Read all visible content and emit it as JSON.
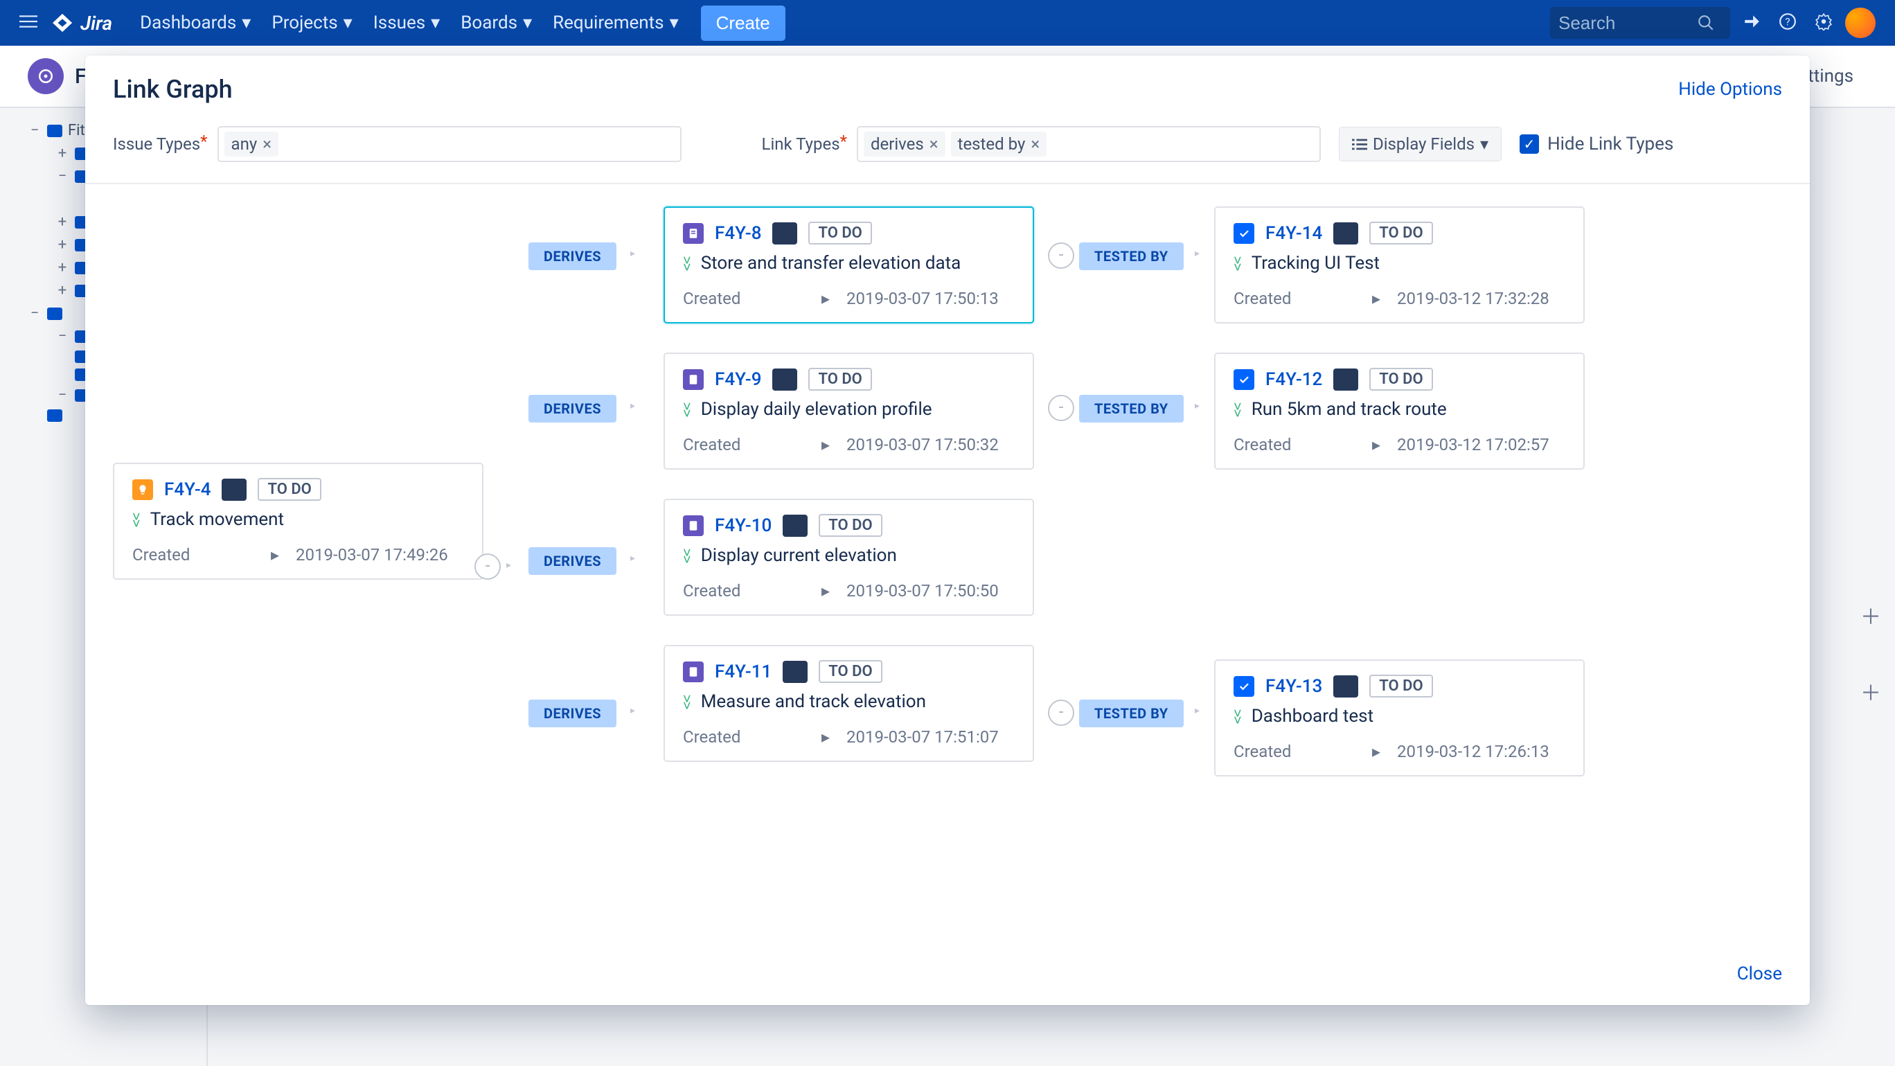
{
  "topnav": {
    "logo": "Jira",
    "menus": [
      "Dashboards",
      "Projects",
      "Issues",
      "Boards",
      "Requirements"
    ],
    "create": "Create",
    "search_placeholder": "Search"
  },
  "subbar": {
    "project_short": "Fit",
    "settings": "Settings"
  },
  "sidebar": {
    "root": "Fit"
  },
  "modal": {
    "title": "Link Graph",
    "hide_options": "Hide Options",
    "close": "Close",
    "filters": {
      "issue_types_label": "Issue Types",
      "issue_types_tags": [
        "any"
      ],
      "link_types_label": "Link Types",
      "link_types_tags": [
        "derives",
        "tested by"
      ],
      "display_fields": "Display Fields",
      "hide_link_types": "Hide Link Types"
    },
    "links": {
      "derives": "DERIVES",
      "tested_by": "TESTED BY"
    },
    "status_todo": "TO DO",
    "meta_created": "Created",
    "cards": {
      "root": {
        "key": "F4Y-4",
        "summary": "Track movement",
        "created": "2019-03-07 17:49:26"
      },
      "mid": [
        {
          "key": "F4Y-8",
          "summary": "Store and transfer elevation data",
          "created": "2019-03-07 17:50:13"
        },
        {
          "key": "F4Y-9",
          "summary": "Display daily elevation profile",
          "created": "2019-03-07 17:50:32"
        },
        {
          "key": "F4Y-10",
          "summary": "Display current elevation",
          "created": "2019-03-07 17:50:50"
        },
        {
          "key": "F4Y-11",
          "summary": "Measure and track elevation",
          "created": "2019-03-07 17:51:07"
        }
      ],
      "right": [
        {
          "key": "F4Y-14",
          "summary": "Tracking UI Test",
          "created": "2019-03-12 17:32:28"
        },
        {
          "key": "F4Y-12",
          "summary": "Run 5km and track route",
          "created": "2019-03-12 17:02:57"
        },
        {
          "key": "F4Y-13",
          "summary": "Dashboard test",
          "created": "2019-03-12 17:26:13"
        }
      ]
    }
  }
}
